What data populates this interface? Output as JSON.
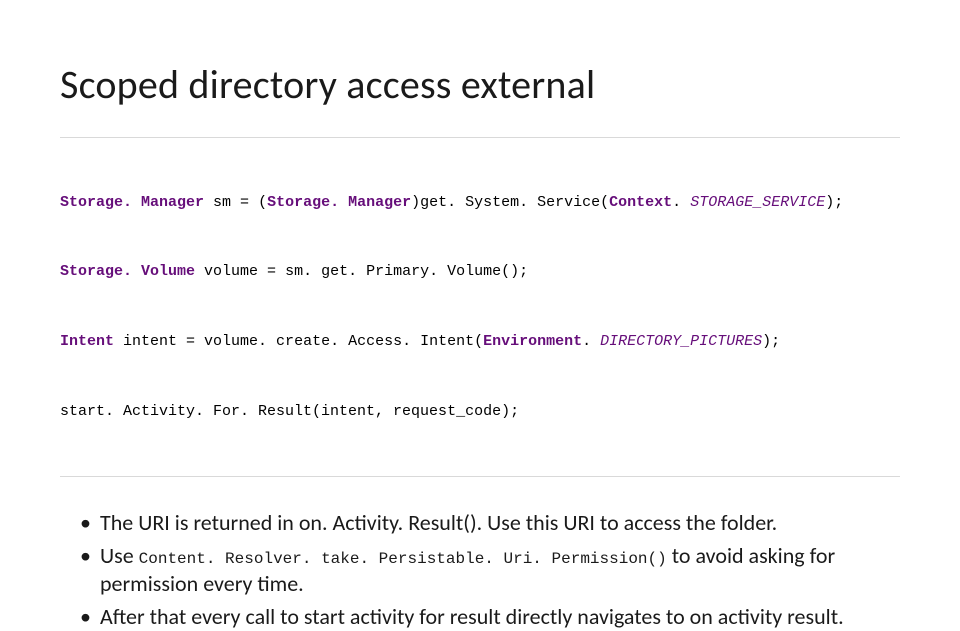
{
  "title": "Scoped directory access external",
  "code": {
    "lines": [
      {
        "tokens": [
          {
            "cls": "tok-type",
            "t": "Storage. Manager"
          },
          {
            "cls": "tok-plain",
            "t": " sm "
          },
          {
            "cls": "tok-op",
            "t": "="
          },
          {
            "cls": "tok-plain",
            "t": " ("
          },
          {
            "cls": "tok-type",
            "t": "Storage. Manager"
          },
          {
            "cls": "tok-plain",
            "t": ")get. System. Service("
          },
          {
            "cls": "tok-type",
            "t": "Context"
          },
          {
            "cls": "tok-plain",
            "t": ". "
          },
          {
            "cls": "tok-const",
            "t": "STORAGE_SERVICE"
          },
          {
            "cls": "tok-plain",
            "t": ");"
          }
        ]
      },
      {
        "tokens": [
          {
            "cls": "tok-type",
            "t": "Storage. Volume"
          },
          {
            "cls": "tok-plain",
            "t": " volume "
          },
          {
            "cls": "tok-op",
            "t": "="
          },
          {
            "cls": "tok-plain",
            "t": " sm. get. Primary. Volume();"
          }
        ]
      },
      {
        "tokens": [
          {
            "cls": "tok-type",
            "t": "Intent"
          },
          {
            "cls": "tok-plain",
            "t": " intent "
          },
          {
            "cls": "tok-op",
            "t": "="
          },
          {
            "cls": "tok-plain",
            "t": " volume. create. Access. Intent("
          },
          {
            "cls": "tok-type",
            "t": "Environment"
          },
          {
            "cls": "tok-plain",
            "t": ". "
          },
          {
            "cls": "tok-const",
            "t": "DIRECTORY_PICTURES"
          },
          {
            "cls": "tok-plain",
            "t": ");"
          }
        ]
      },
      {
        "tokens": [
          {
            "cls": "tok-plain",
            "t": "start. Activity. For. Result(intent, request_code);"
          }
        ]
      }
    ]
  },
  "bullets": [
    {
      "pre": "The URI is returned in on. Activity. Result(). Use this URI to access the folder.",
      "code": "",
      "post": ""
    },
    {
      "pre": "Use ",
      "code": "Content. Resolver. take. Persistable. Uri. Permission()",
      "post": " to avoid asking for permission every time."
    },
    {
      "pre": "After that every call to start activity for result directly navigates to on activity result.",
      "code": "",
      "post": ""
    }
  ]
}
